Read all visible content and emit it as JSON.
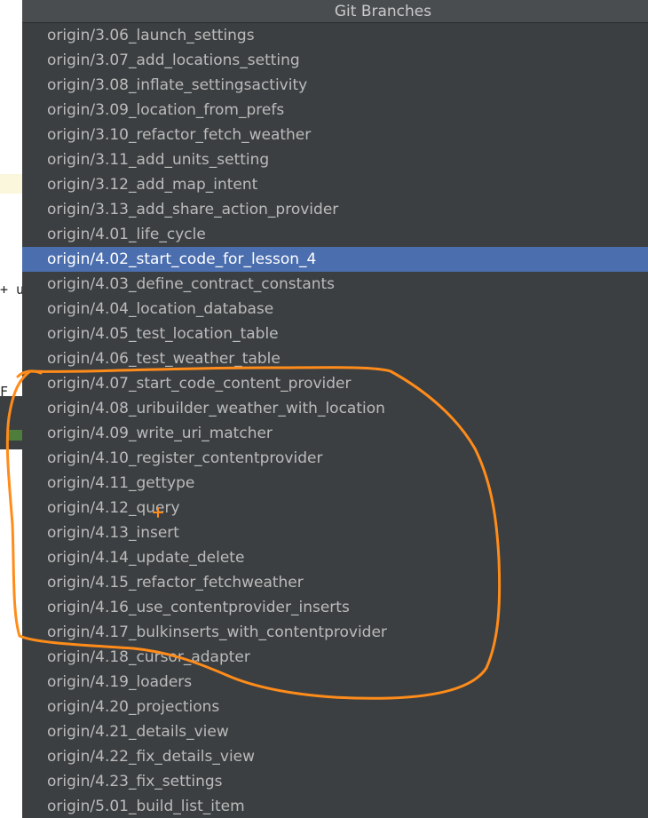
{
  "popup": {
    "title": "Git Branches",
    "selected_index": 9,
    "branches": [
      "origin/3.06_launch_settings",
      "origin/3.07_add_locations_setting",
      "origin/3.08_inflate_settingsactivity",
      "origin/3.09_location_from_prefs",
      "origin/3.10_refactor_fetch_weather",
      "origin/3.11_add_units_setting",
      "origin/3.12_add_map_intent",
      "origin/3.13_add_share_action_provider",
      "origin/4.01_life_cycle",
      "origin/4.02_start_code_for_lesson_4",
      "origin/4.03_define_contract_constants",
      "origin/4.04_location_database",
      "origin/4.05_test_location_table",
      "origin/4.06_test_weather_table",
      "origin/4.07_start_code_content_provider",
      "origin/4.08_uribuilder_weather_with_location",
      "origin/4.09_write_uri_matcher",
      "origin/4.10_register_contentprovider",
      "origin/4.11_gettype",
      "origin/4.12_query",
      "origin/4.13_insert",
      "origin/4.14_update_delete",
      "origin/4.15_refactor_fetchweather",
      "origin/4.16_use_contentprovider_inserts",
      "origin/4.17_bulkinserts_with_contentprovider",
      "origin/4.18_cursor_adapter",
      "origin/4.19_loaders",
      "origin/4.20_projections",
      "origin/4.21_details_view",
      "origin/4.22_fix_details_view",
      "origin/4.23_fix_settings",
      "origin/5.01_build_list_item"
    ]
  },
  "editor_strip": {
    "fragment_1": "+ u",
    "fragment_2": "F"
  },
  "colors": {
    "popup_bg": "#3c3f41",
    "header_bg": "#4a4d50",
    "selection": "#4b6eaf",
    "item_text": "#bbbbbb",
    "annotation": "#ff8c1a"
  }
}
